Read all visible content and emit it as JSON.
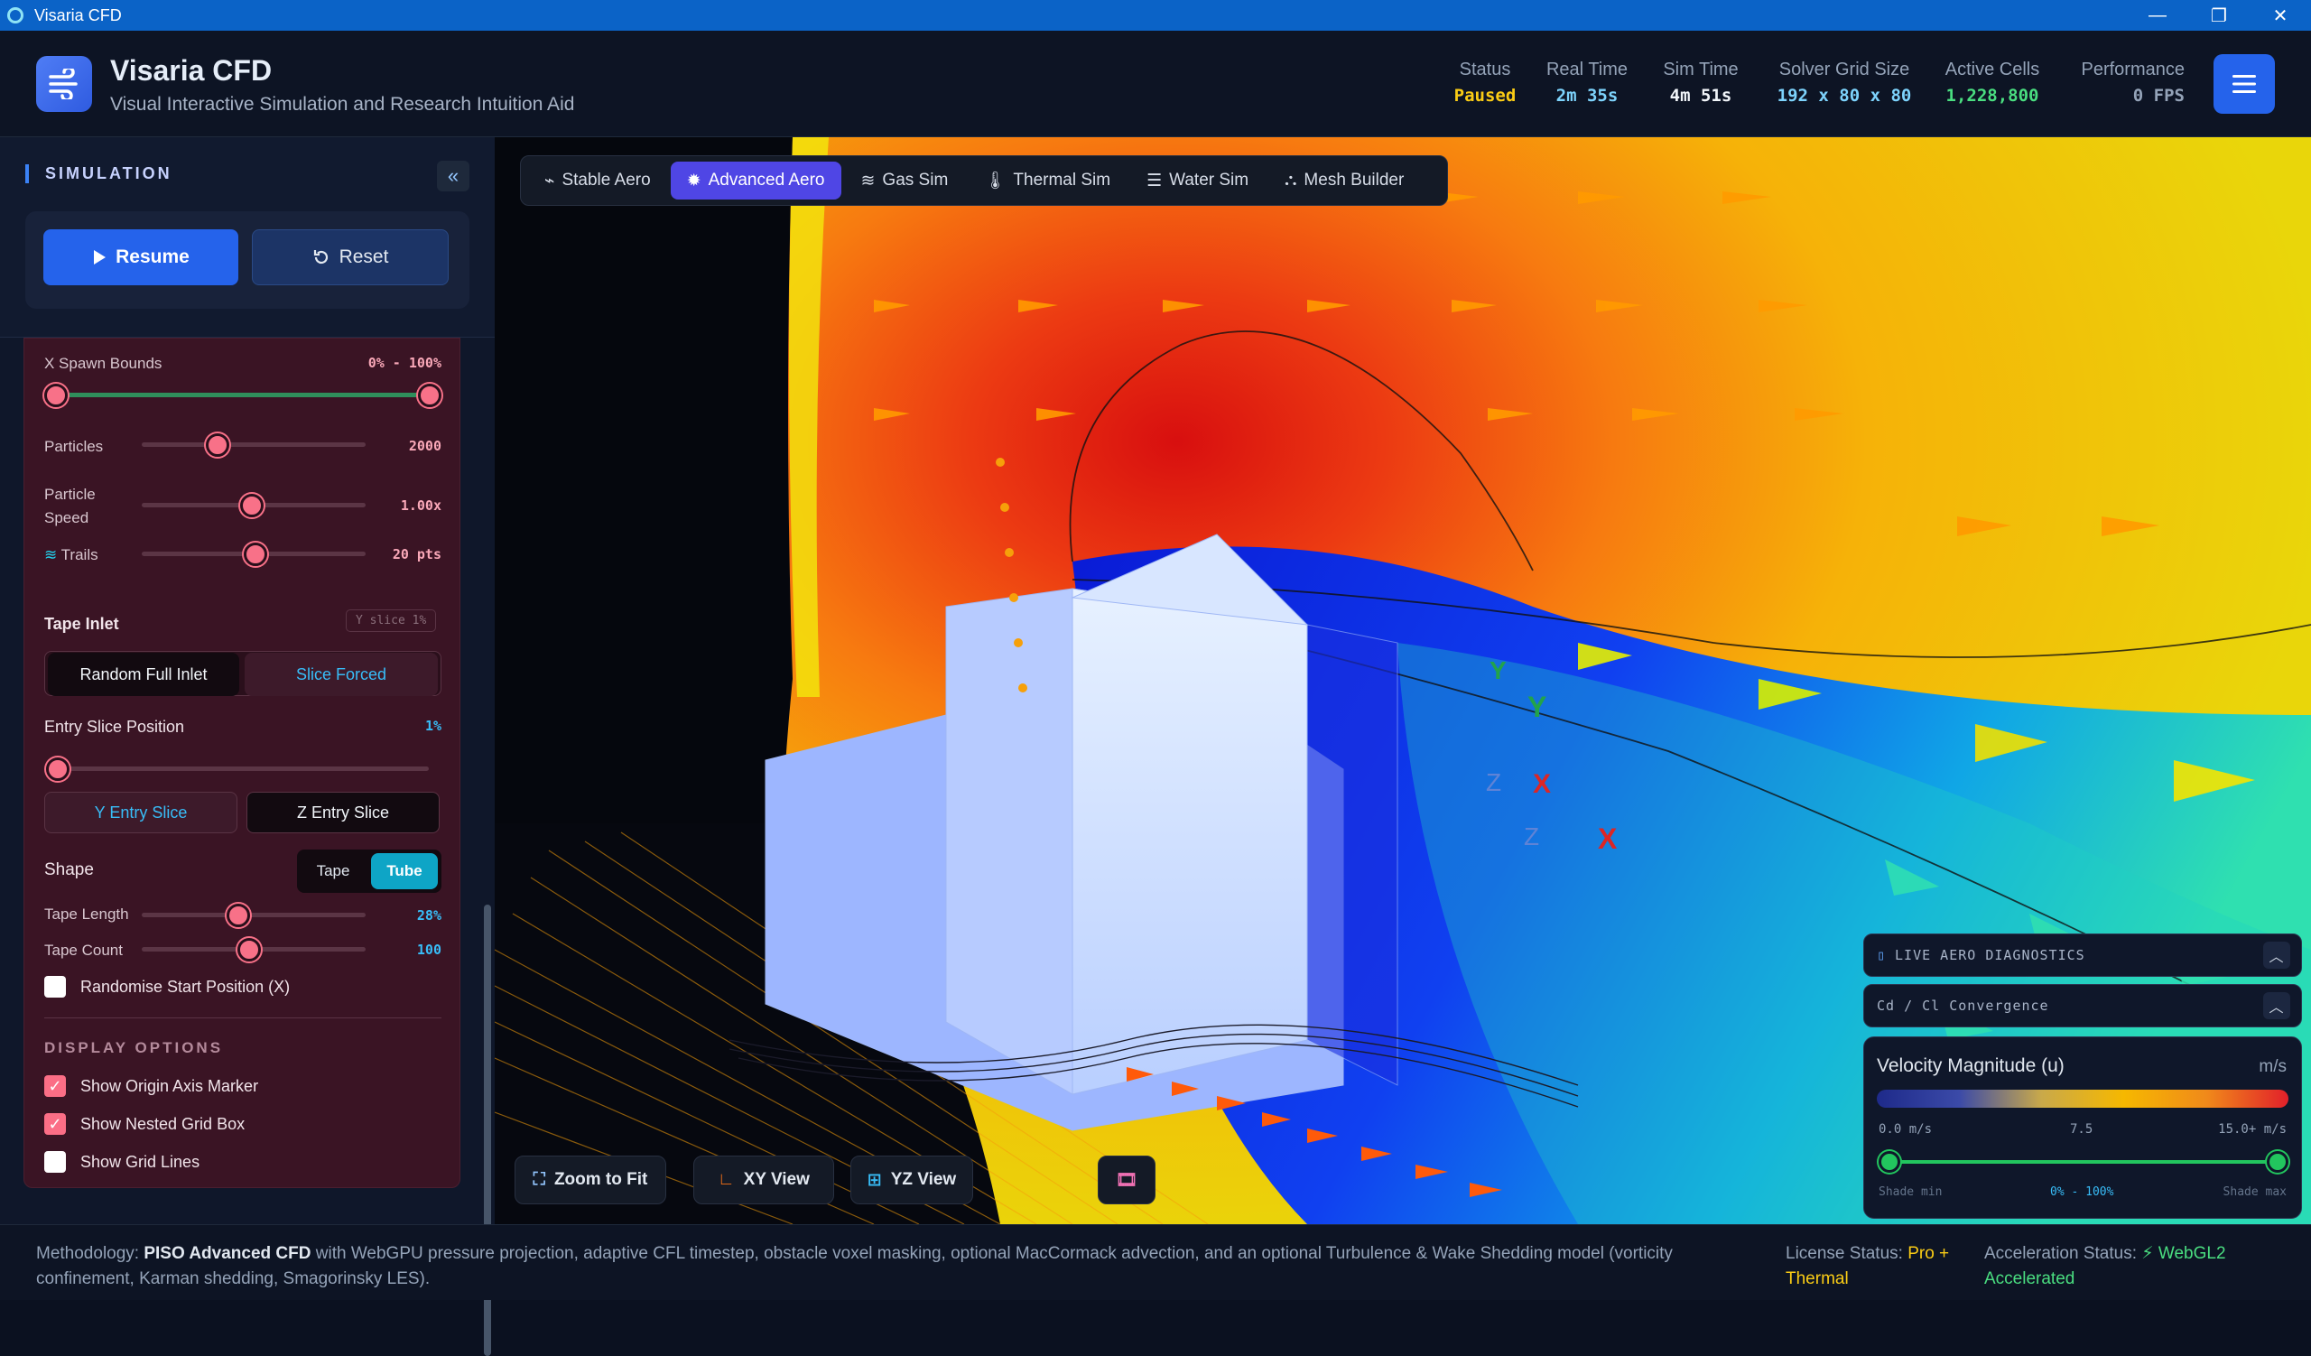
{
  "window": {
    "title": "Visaria CFD",
    "minimize": "—",
    "restore": "❐",
    "close": "✕"
  },
  "header": {
    "title": "Visaria CFD",
    "subtitle": "Visual Interactive Simulation and Research Intuition Aid",
    "stats": [
      {
        "label": "Status",
        "value": "Paused",
        "color": "#facc15"
      },
      {
        "label": "Real Time",
        "value": "2m 35s",
        "color": "#7dd3fc"
      },
      {
        "label": "Sim Time",
        "value": "4m 51s",
        "color": "#f1f5f9"
      },
      {
        "label": "Solver Grid Size",
        "value": "192 x 80 x 80",
        "color": "#7dd3fc"
      },
      {
        "label": "Active Cells",
        "value": "1,228,800",
        "color": "#4ade80"
      },
      {
        "label": "Performance",
        "value": "0 FPS",
        "color": "#94a3b8"
      }
    ]
  },
  "sidebar": {
    "section_title": "SIMULATION",
    "resume_label": "Resume",
    "reset_label": "Reset",
    "x_spawn": {
      "label": "X Spawn Bounds",
      "value": "0% - 100%"
    },
    "particles": {
      "label": "Particles",
      "value": "2000",
      "level": 0.34
    },
    "particle_speed": {
      "label": "Particle Speed",
      "value": "1.00x",
      "level": 0.49
    },
    "trails": {
      "label": "Trails",
      "value": "20 pts",
      "level": 0.51
    },
    "tape_inlet": {
      "label": "Tape Inlet",
      "badge": "Y slice 1%",
      "opt_random": "Random Full Inlet",
      "opt_slice": "Slice Forced"
    },
    "entry_slice": {
      "label": "Entry Slice Position",
      "value": "1%",
      "opt_y": "Y Entry Slice",
      "opt_z": "Z Entry Slice"
    },
    "shape": {
      "label": "Shape",
      "opt_tape": "Tape",
      "opt_tube": "Tube"
    },
    "tape_length": {
      "label": "Tape Length",
      "value": "28%",
      "level": 0.43
    },
    "tape_count": {
      "label": "Tape Count",
      "value": "100",
      "level": 0.48
    },
    "randomise": {
      "label": "Randomise Start Position (X)"
    },
    "display": {
      "heading": "DISPLAY OPTIONS",
      "origin_axis": "Show Origin Axis Marker",
      "nested_grid": "Show Nested Grid Box",
      "grid_lines": "Show Grid Lines"
    }
  },
  "viewport": {
    "modes": [
      "Stable Aero",
      "Advanced Aero",
      "Gas Sim",
      "Thermal Sim",
      "Water Sim",
      "Mesh Builder"
    ],
    "active_mode": "Advanced Aero",
    "zoom_fit": "Zoom to Fit",
    "xy_view": "XY View",
    "yz_view": "YZ View",
    "axis_labels": {
      "y": "Y",
      "x": "X",
      "z": "Z"
    }
  },
  "diagnostics": {
    "live": "LIVE AERO DIAGNOSTICS",
    "convergence": "Cd / Cl Convergence",
    "legend_title": "Velocity Magnitude (u)",
    "legend_unit": "m/s",
    "min": "0.0 m/s",
    "mid": "7.5",
    "max": "15.0+ m/s",
    "shade_min": "Shade min",
    "shade_range": "0% - 100%",
    "shade_max": "Shade max"
  },
  "footer": {
    "methodology_prefix": "Methodology:",
    "methodology_bold": "PISO Advanced CFD",
    "methodology_text": "with WebGPU pressure projection, adaptive CFL timestep, obstacle voxel masking, optional MacCormack advection, and an optional Turbulence & Wake Shedding model (vorticity confinement, Karman shedding, Smagorinsky LES).",
    "license_label": "License Status:",
    "license_value": "Pro + Thermal",
    "accel_label": "Acceleration Status:",
    "accel_value": "⚡ WebGL2 Accelerated"
  }
}
